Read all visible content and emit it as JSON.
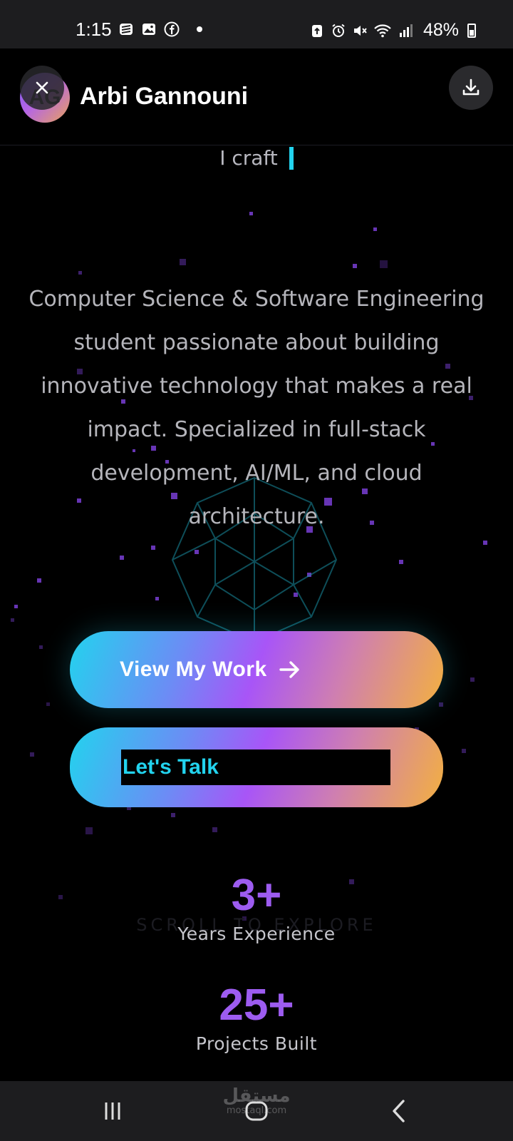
{
  "status_bar": {
    "time": "1:15",
    "battery": "48%",
    "left_icons": [
      "stack-icon",
      "gallery-icon",
      "facebook-icon"
    ],
    "right_icons": [
      "save-icon",
      "alarm-icon",
      "mute-icon",
      "wifi-icon",
      "signal-icon"
    ]
  },
  "header": {
    "avatar_initials": "AG",
    "name": "Arbi Gannouni"
  },
  "hero": {
    "typed_text": "I craft",
    "bio": "Computer Science & Software Engineering student passionate about building innovative technology that makes a real impact. Specialized in full-stack development, AI/ML, and cloud architecture.",
    "buttons": {
      "view_work": "View My Work",
      "lets_talk": "Let's Talk"
    },
    "scroll_hint": "SCROLL TO EXPLORE"
  },
  "stats": [
    {
      "value": "3+",
      "label": "Years Experience"
    },
    {
      "value": "25+",
      "label": "Projects Built"
    }
  ],
  "nav": {
    "watermark": "مستقل",
    "watermark_sub": "mostaql.com"
  },
  "colors": {
    "accent_cyan": "#22d3ee",
    "accent_purple": "#a855f7",
    "accent_orange": "#f3b040",
    "stat_purple": "#9d5cf0"
  }
}
